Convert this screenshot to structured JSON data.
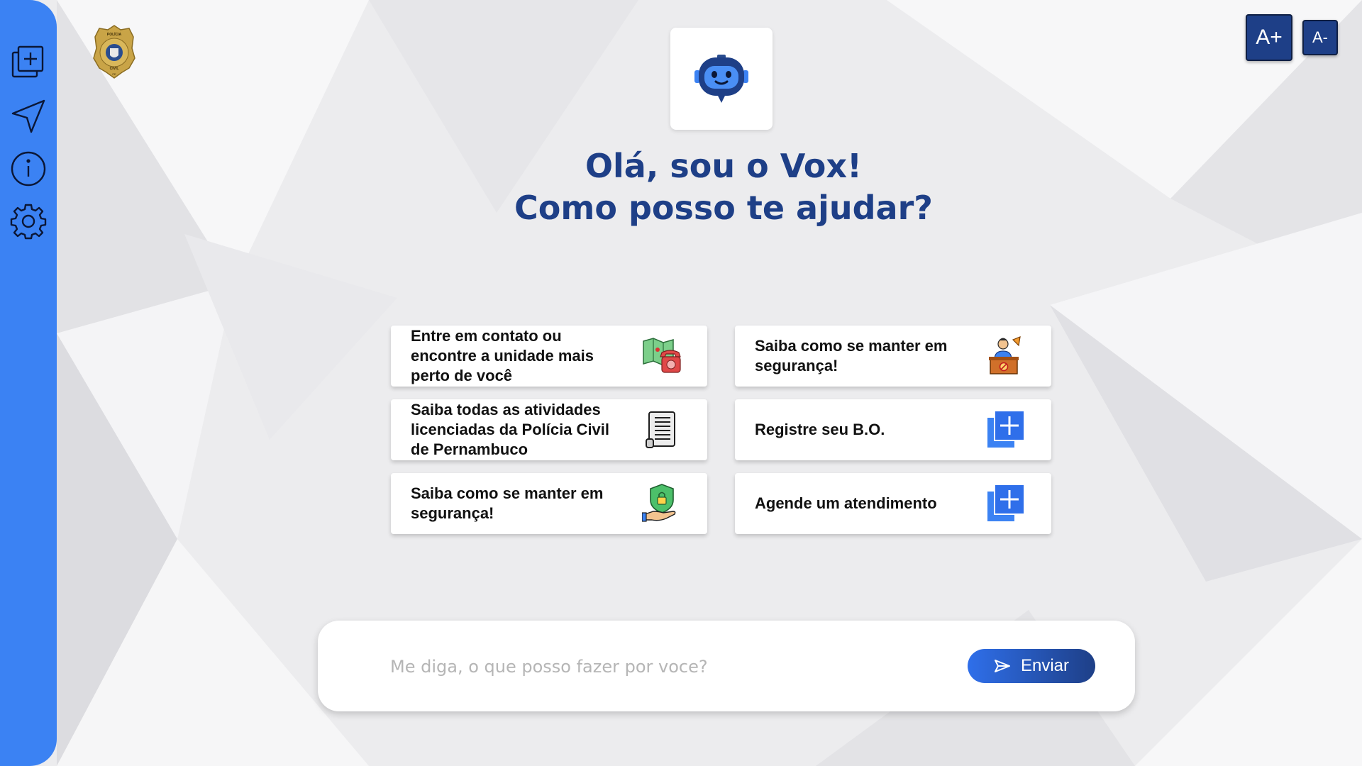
{
  "header": {
    "font_increase_label": "A+",
    "font_decrease_label": "A-",
    "badge_text_top": "POLÍCIA",
    "badge_text_bottom": "CIVIL",
    "badge_text_state": "PE"
  },
  "sidebar": {
    "items": [
      {
        "icon": "new-chat-icon"
      },
      {
        "icon": "navigation-arrow-icon"
      },
      {
        "icon": "info-icon"
      },
      {
        "icon": "gear-icon"
      }
    ]
  },
  "greeting": {
    "line1": "Olá, sou o Vox!",
    "line2": "Como posso te ajudar?"
  },
  "cards": [
    {
      "label": "Entre em contato ou encontre a unidade mais perto de você",
      "icon": "map-phone-icon"
    },
    {
      "label": "Saiba como se manter em segurança!",
      "icon": "officer-desk-icon"
    },
    {
      "label": "Saiba todas as atividades licenciadas da Polícia Civil de Pernambuco",
      "icon": "document-scroll-icon"
    },
    {
      "label": "Registre seu B.O.",
      "icon": "add-copy-icon"
    },
    {
      "label": "Saiba como se manter em segurança!",
      "icon": "shield-lock-hand-icon"
    },
    {
      "label": "Agende um atendimento",
      "icon": "add-copy-icon"
    }
  ],
  "chat": {
    "placeholder": "Me diga, o que posso fazer por voce?",
    "send_label": "Enviar"
  },
  "colors": {
    "sidebar": "#3b82f3",
    "heading": "#1e3f87",
    "accent": "#2f6fea",
    "button_dark": "#1e3f87"
  }
}
